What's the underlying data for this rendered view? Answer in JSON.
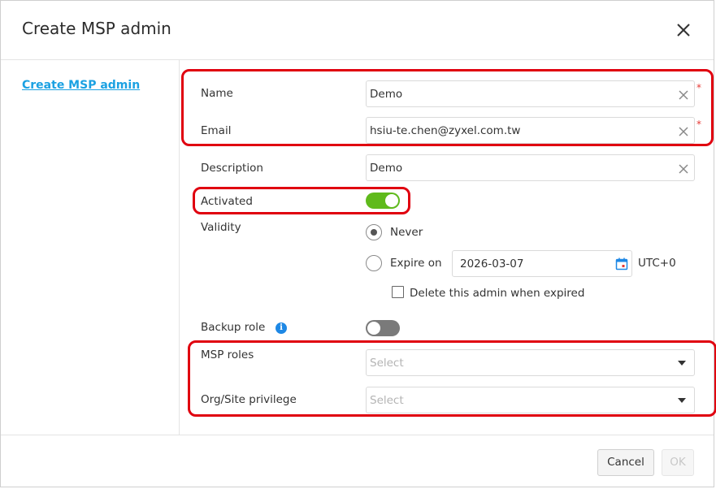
{
  "dialog": {
    "title": "Create MSP admin"
  },
  "sidebar": {
    "items": [
      {
        "label": "Create MSP admin"
      }
    ]
  },
  "form": {
    "name": {
      "label": "Name",
      "value": "Demo",
      "required_mark": "*"
    },
    "email": {
      "label": "Email",
      "value": "hsiu-te.chen@zyxel.com.tw",
      "required_mark": "*"
    },
    "description": {
      "label": "Description",
      "value": "Demo"
    },
    "activated": {
      "label": "Activated",
      "state": "on"
    },
    "validity": {
      "label": "Validity",
      "option_never": "Never",
      "option_expire": "Expire on",
      "selected": "Never",
      "expire_date": "2026-03-07",
      "timezone": "UTC+0",
      "delete_when_expired_label": "Delete this admin when expired",
      "delete_when_expired_checked": false
    },
    "backup_role": {
      "label": "Backup role",
      "state": "off",
      "info_icon": "i"
    },
    "msp_roles": {
      "label": "MSP roles",
      "placeholder": "Select"
    },
    "org_site_privilege": {
      "label": "Org/Site privilege",
      "placeholder": "Select"
    }
  },
  "footer": {
    "cancel_label": "Cancel",
    "ok_label": "OK"
  },
  "colors": {
    "accent_link": "#1ba1e2",
    "toggle_on": "#5fba1c",
    "toggle_off": "#7a7a7a",
    "highlight": "#e0000f",
    "required": "#e53935",
    "info": "#1e88e5"
  }
}
